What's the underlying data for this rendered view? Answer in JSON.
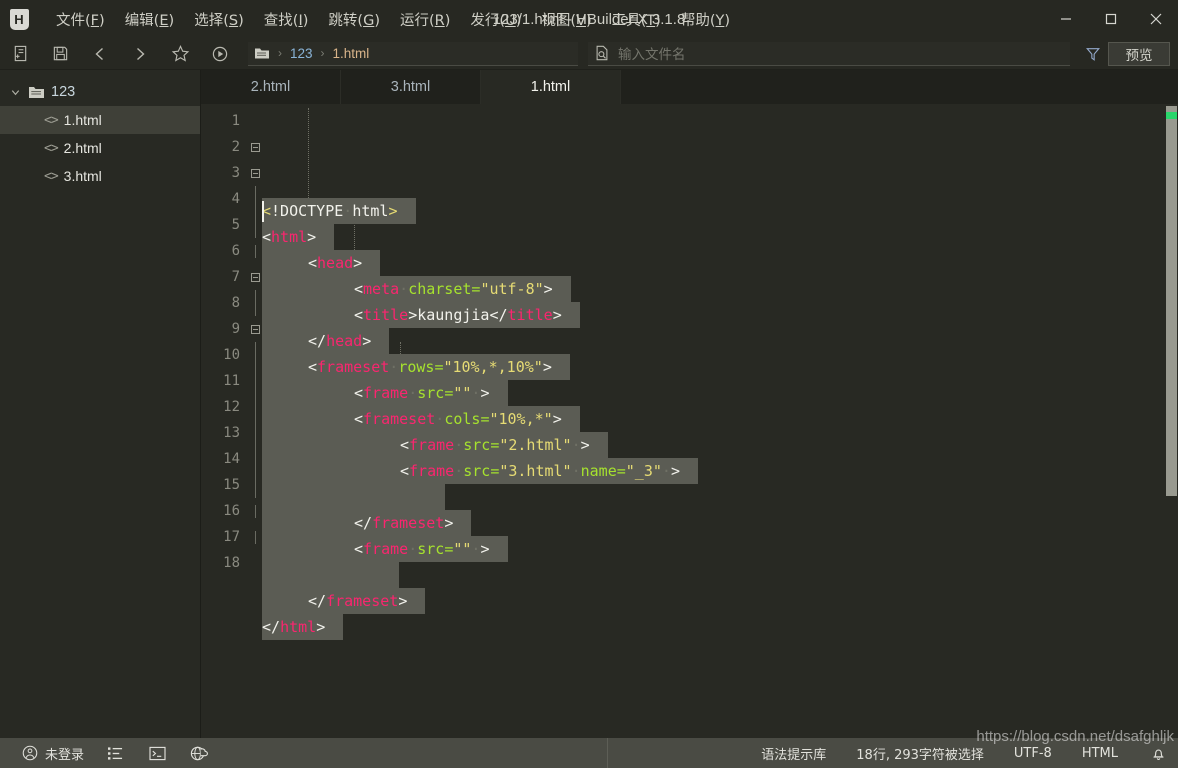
{
  "window": {
    "title": "123/1.html - HBuilder X 3.1.8",
    "logo_glyph": "H",
    "controls": {
      "minimize": "minimize-icon",
      "maximize": "maximize-icon",
      "close": "close-icon"
    }
  },
  "menubar": {
    "items": [
      {
        "label": "文件",
        "accel": "F"
      },
      {
        "label": "编辑",
        "accel": "E"
      },
      {
        "label": "选择",
        "accel": "S"
      },
      {
        "label": "查找",
        "accel": "I"
      },
      {
        "label": "跳转",
        "accel": "G"
      },
      {
        "label": "运行",
        "accel": "R"
      },
      {
        "label": "发行",
        "accel": "U"
      },
      {
        "label": "视图",
        "accel": "V"
      },
      {
        "label": "工具",
        "accel": "T"
      },
      {
        "label": "帮助",
        "accel": "Y"
      }
    ]
  },
  "toolbar": {
    "icons": [
      "new-file-icon",
      "save-icon",
      "back-arrow-icon",
      "forward-arrow-icon",
      "favorite-star-icon",
      "run-play-icon"
    ],
    "breadcrumb": {
      "folder_icon": "folder-icon",
      "project": "123",
      "file": "1.html",
      "separator": "›"
    },
    "filename_search": {
      "icon": "file-search-icon",
      "placeholder": "输入文件名",
      "value": ""
    },
    "filter_icon": "filter-funnel-icon",
    "preview_label": "预览"
  },
  "sidebar": {
    "root": {
      "label": "123",
      "expanded": true,
      "chevron": "chevron-down-icon",
      "icon": "folder-icon"
    },
    "files": [
      {
        "label": "1.html",
        "icon": "code-file-icon",
        "selected": true
      },
      {
        "label": "2.html",
        "icon": "code-file-icon",
        "selected": false
      },
      {
        "label": "3.html",
        "icon": "code-file-icon",
        "selected": false
      }
    ]
  },
  "tabs": [
    {
      "label": "2.html",
      "active": false
    },
    {
      "label": "3.html",
      "active": false
    },
    {
      "label": "1.html",
      "active": true
    }
  ],
  "editor": {
    "language": "HTML",
    "line_numbers": [
      "1",
      "2",
      "3",
      "4",
      "5",
      "6",
      "7",
      "8",
      "9",
      "10",
      "11",
      "12",
      "13",
      "14",
      "15",
      "16",
      "17",
      "18"
    ],
    "lines": [
      "<!DOCTYPE html>",
      "<html>",
      "    <head>",
      "        <meta charset=\"utf-8\">",
      "        <title>kaungjia</title>",
      "    </head>",
      "    <frameset rows=\"10%,*,10%\">",
      "        <frame src=\"\" >",
      "        <frameset cols=\"10%,*\">",
      "            <frame src=\"2.html\" >",
      "            <frame src=\"3.html\" name=\"_3\" >",
      "            ",
      "        </frameset>",
      "        <frame src=\"\" >",
      "        ",
      "    </frameset>",
      "</html>",
      ""
    ],
    "title_text": "kaungjia",
    "scrollbar": {
      "marker_color": "#29d66b"
    }
  },
  "statusbar": {
    "login_label": "未登录",
    "login_icon": "user-circle-icon",
    "icons": [
      "outline-list-icon",
      "terminal-icon",
      "network-cloud-icon"
    ],
    "syntax_library": "语法提示库",
    "selection_info": "18行, 293字符被选择",
    "encoding": "UTF-8",
    "language": "HTML",
    "bell_icon": "bell-icon",
    "watermark": "https://blog.csdn.net/dsafghljk"
  },
  "colors": {
    "bg": "#282923",
    "titlebar": "#272822",
    "statusbar": "#4a4b44",
    "selection": "#5b5c54",
    "tag": "#f9266f",
    "attr": "#a6e22e",
    "string": "#e6db74",
    "text": "#f2f2ec",
    "accent_green": "#29d66b"
  }
}
